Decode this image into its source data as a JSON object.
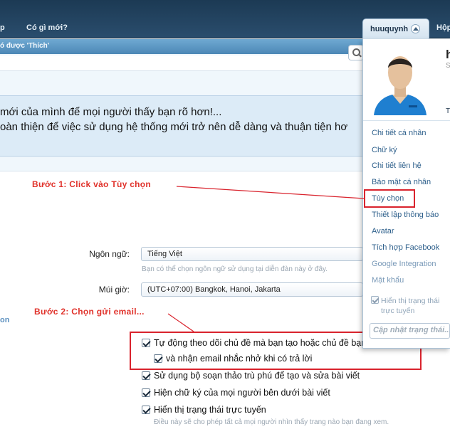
{
  "topnav": {
    "item_cut": "p",
    "item_whats_new": "Có gì mới?",
    "username": "huuquynh",
    "item_inbox_cut": "Hộp"
  },
  "subnav": {
    "text": "ó được 'Thích'"
  },
  "notice": {
    "line1": "mới của mình để mọi người thấy bạn rõ hơn!...",
    "line2": "oàn thiện để việc sử dụng hệ thống mới trở nên dễ dàng và thuận tiện hơ"
  },
  "steps": {
    "step1": "Bước 1: Click vào Tùy chọn",
    "step2": "Bước 2: Chọn gửi email..."
  },
  "form": {
    "language_label": "Ngôn ngữ:",
    "language_value": "Tiếng Việt",
    "language_hint": "Bạn có thể chọn ngôn ngữ sử dụng tại diễn đàn này ở đây.",
    "timezone_label": "Múi giờ:",
    "timezone_value": "(UTC+07:00) Bangkok, Hanoi, Jakarta",
    "partial_heading": "on",
    "checkboxes": [
      {
        "label": "Tự động theo dõi chủ đề mà bạn tạo hoặc chủ đề bạn trả lời..."
      },
      {
        "label": "và nhận email nhắc nhở khi có trả lời"
      },
      {
        "label": "Sử dụng bộ soạn thảo trù phú để tạo và sửa bài viết"
      },
      {
        "label": "Hiện chữ ký của mọi người bên dưới bài viết"
      },
      {
        "label": "Hiển thị trạng thái trực tuyến"
      }
    ],
    "online_hint": "Điều này sẽ cho phép tất cả mọi người nhìn thấy trang nào bạn đang xem."
  },
  "menu": {
    "profile_name_cut": "h",
    "profile_sub_cut": "S",
    "profile_more_cut": "T",
    "items": [
      {
        "label": "Chi tiết cá nhân"
      },
      {
        "label": "Chữ ký"
      },
      {
        "label": "Chi tiết liên hệ"
      },
      {
        "label": "Bảo mật cá nhân"
      },
      {
        "label": "Tùy chọn"
      },
      {
        "label": "Thiết lập thông báo"
      },
      {
        "label": "Avatar"
      },
      {
        "label": "Tích hợp Facebook"
      },
      {
        "label": "Google Integration"
      },
      {
        "label": "Mật khẩu"
      }
    ],
    "online_toggle_label": "Hiển thị trạng thái trực tuyến",
    "status_placeholder": "Cập nhật trạng thái..."
  },
  "colors": {
    "nav_bg": "#1c3a54",
    "menu_link": "#2d5f8b",
    "annotation_red": "#d9232d"
  }
}
